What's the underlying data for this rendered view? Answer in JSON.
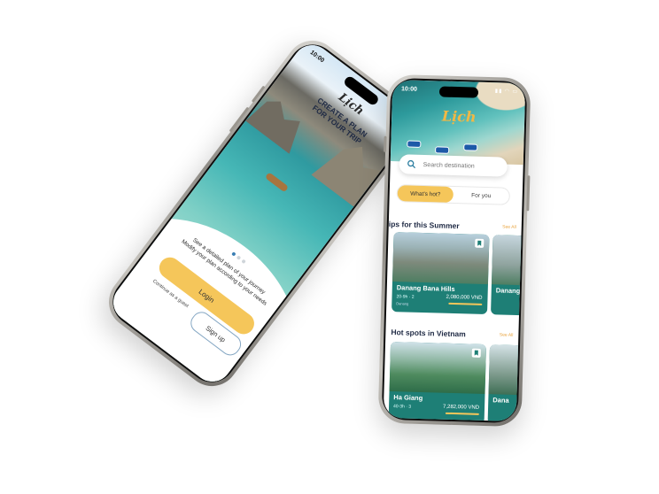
{
  "welcome_screen": {
    "status_time": "10:00",
    "logo_text": "Lịch",
    "title_line1": "CREATE A PLAN",
    "title_line2": "FOR YOUR TRIP",
    "description_line1": "See a detailed plan of your journey",
    "description_line2": "Modify your plan according to your needs",
    "login_label": "Login",
    "guest_label": "Continue as a guest",
    "signup_label": "Sign up"
  },
  "home_screen": {
    "status_time": "10:00",
    "logo_text": "Lịch",
    "search": {
      "placeholder": "Search destination"
    },
    "tabs": [
      {
        "label": "What's hot?",
        "active": true
      },
      {
        "label": "For you",
        "active": false
      }
    ],
    "section_summer": {
      "title": "Trips for this Summer",
      "see_all": "See All",
      "cards": [
        {
          "name": "Danang Bana Hills",
          "meta": "20-9h  ·  2",
          "price": "2,080,000 VND",
          "sub": "Danang"
        },
        {
          "name": "Danang",
          "meta": "",
          "price": "",
          "sub": ""
        }
      ]
    },
    "section_hotspots": {
      "title": "Hot spots in Vietnam",
      "see_all": "See All",
      "cards": [
        {
          "name": "Ha Giang",
          "meta": "40-3h  ·  3",
          "price": "7,282,000 VND",
          "sub": ""
        },
        {
          "name": "Dana",
          "meta": "",
          "price": "",
          "sub": ""
        }
      ]
    }
  },
  "colors": {
    "accent_yellow": "#f5c65a",
    "navy_text": "#1f2a44",
    "see_all_orange": "#e8a23a",
    "card_teal": "#1e7f76"
  }
}
